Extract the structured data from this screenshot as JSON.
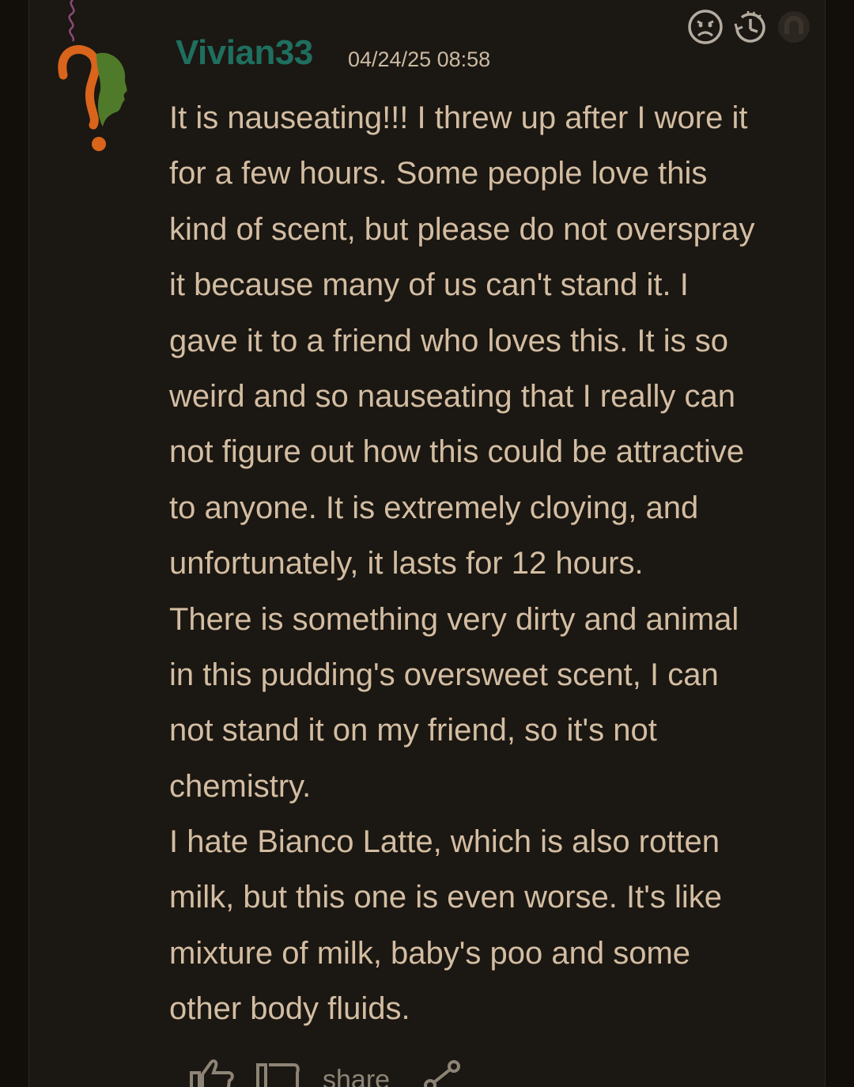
{
  "review": {
    "username": "Vivian33",
    "timestamp": "04/24/25 08:58",
    "lines": [
      "It is nauseating!!! I threw up after I wore it",
      "for a few hours. Some people love this",
      "kind of scent, but please do not overspray",
      "it because many of us can't stand it. I",
      "gave it to a friend who loves this. It is so",
      "weird and so nauseating that I really can",
      "not figure out how this could be attractive",
      "to anyone. It is extremely cloying, and",
      "unfortunately, it lasts for 12 hours.",
      "There is something very dirty and animal",
      "in this pudding's oversweet scent, I can",
      "not stand it on my friend, so it's not",
      "chemistry.",
      "I hate Bianco Latte, which is also rotten",
      "milk, but this one is even worse. It's like",
      "mixture of milk, baby's poo and some",
      "other body fluids."
    ]
  },
  "header_icons": [
    "sad-face-icon",
    "clock-history-icon",
    "gender-icon"
  ],
  "actions": {
    "share_label": "share",
    "icons": [
      "thumbs-up-icon",
      "comment-icon",
      "share-icon"
    ]
  },
  "colors": {
    "background": "#120f0b",
    "card": "#1b1712",
    "username": "#1f6f5f",
    "text": "#d3bda2",
    "icon": "#b5aca1",
    "avatar_orange": "#d9641c",
    "avatar_green": "#4f7a2a"
  }
}
